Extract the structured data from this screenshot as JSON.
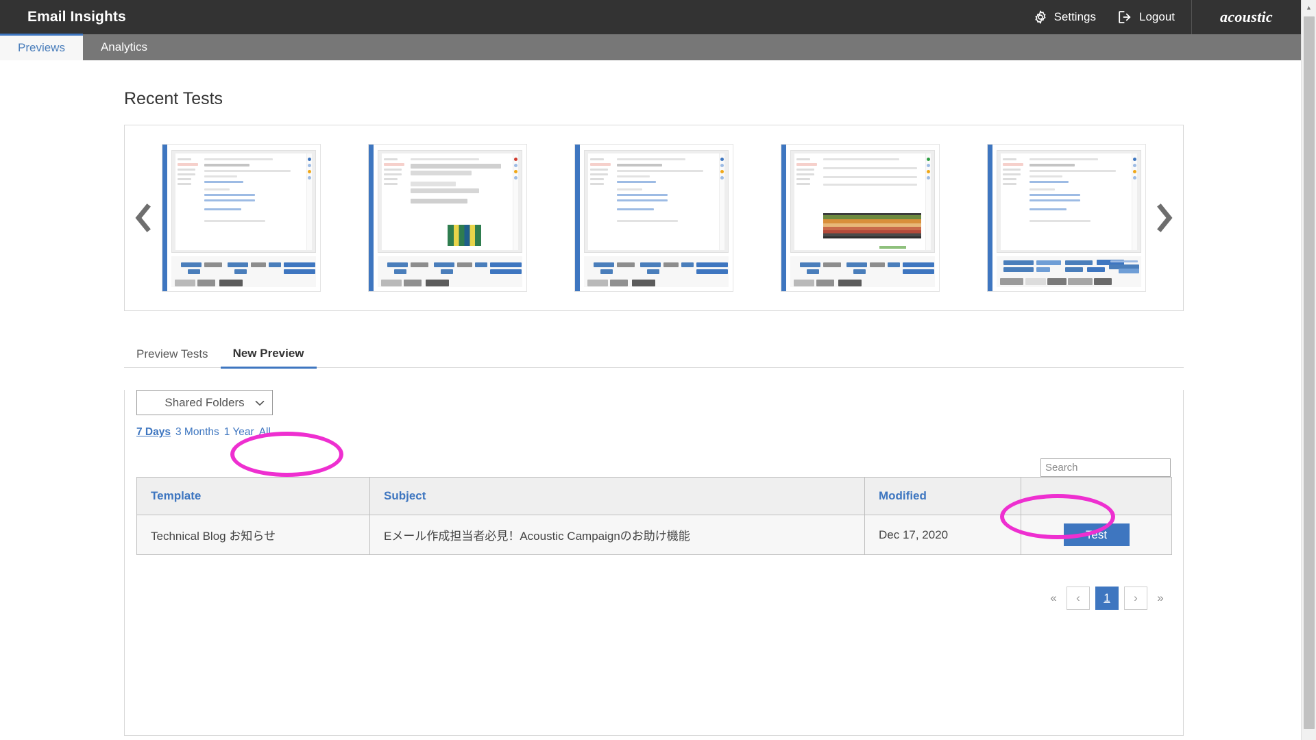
{
  "header": {
    "app_title": "Email Insights",
    "settings_label": "Settings",
    "logout_label": "Logout",
    "brand": "acoustic",
    "settings_icon": "gear-icon",
    "logout_icon": "logout-icon",
    "bg_color": "#333333"
  },
  "nav": {
    "tabs": [
      {
        "label": "Previews",
        "active": true
      },
      {
        "label": "Analytics",
        "active": false
      }
    ],
    "bg_color": "#777777",
    "active_accent": "#3e76c0"
  },
  "main": {
    "page_title": "Recent Tests"
  },
  "carousel": {
    "prev_icon": "chevron-left-icon",
    "next_icon": "chevron-right-icon",
    "accent_color": "#3e76c0",
    "items": [
      {
        "name": "recent-test-thumbnail-1",
        "variant": "text"
      },
      {
        "name": "recent-test-thumbnail-2",
        "variant": "green-block"
      },
      {
        "name": "recent-test-thumbnail-3",
        "variant": "text"
      },
      {
        "name": "recent-test-thumbnail-4",
        "variant": "color-bars"
      },
      {
        "name": "recent-test-thumbnail-5",
        "variant": "wide-lines"
      }
    ]
  },
  "subtabs": {
    "tabs": [
      {
        "label": "Preview Tests",
        "active": false
      },
      {
        "label": "New Preview",
        "active": true
      }
    ]
  },
  "annotations": {
    "color": "#ee2fd0",
    "shapes": [
      {
        "name": "annotation-ellipse-new-preview",
        "target": "New Preview"
      },
      {
        "name": "annotation-ellipse-test-button",
        "target": "Test"
      }
    ]
  },
  "list_panel": {
    "folder_select": {
      "selected": "Shared Folders",
      "icon": "chevron-down-icon",
      "options": [
        "Shared Folders"
      ]
    },
    "date_filters": [
      {
        "label": "7 Days",
        "active": true
      },
      {
        "label": "3 Months",
        "active": false
      },
      {
        "label": "1 Year",
        "active": false
      },
      {
        "label": "All",
        "active": false
      }
    ],
    "search": {
      "placeholder": "Search",
      "value": ""
    },
    "table": {
      "columns": [
        "Template",
        "Subject",
        "Modified",
        ""
      ],
      "rows": [
        {
          "template": "Technical Blog お知らせ",
          "subject": "Eメール作成担当者必見！Acoustic Campaignのお助け機能",
          "modified": "Dec 17, 2020",
          "action": "Test"
        }
      ]
    },
    "pagination": {
      "first": "«",
      "prev": "‹",
      "pages": [
        "1"
      ],
      "current": "1",
      "next": "›",
      "last": "»"
    }
  },
  "scrollbar": {
    "up_arrow": "▲"
  }
}
